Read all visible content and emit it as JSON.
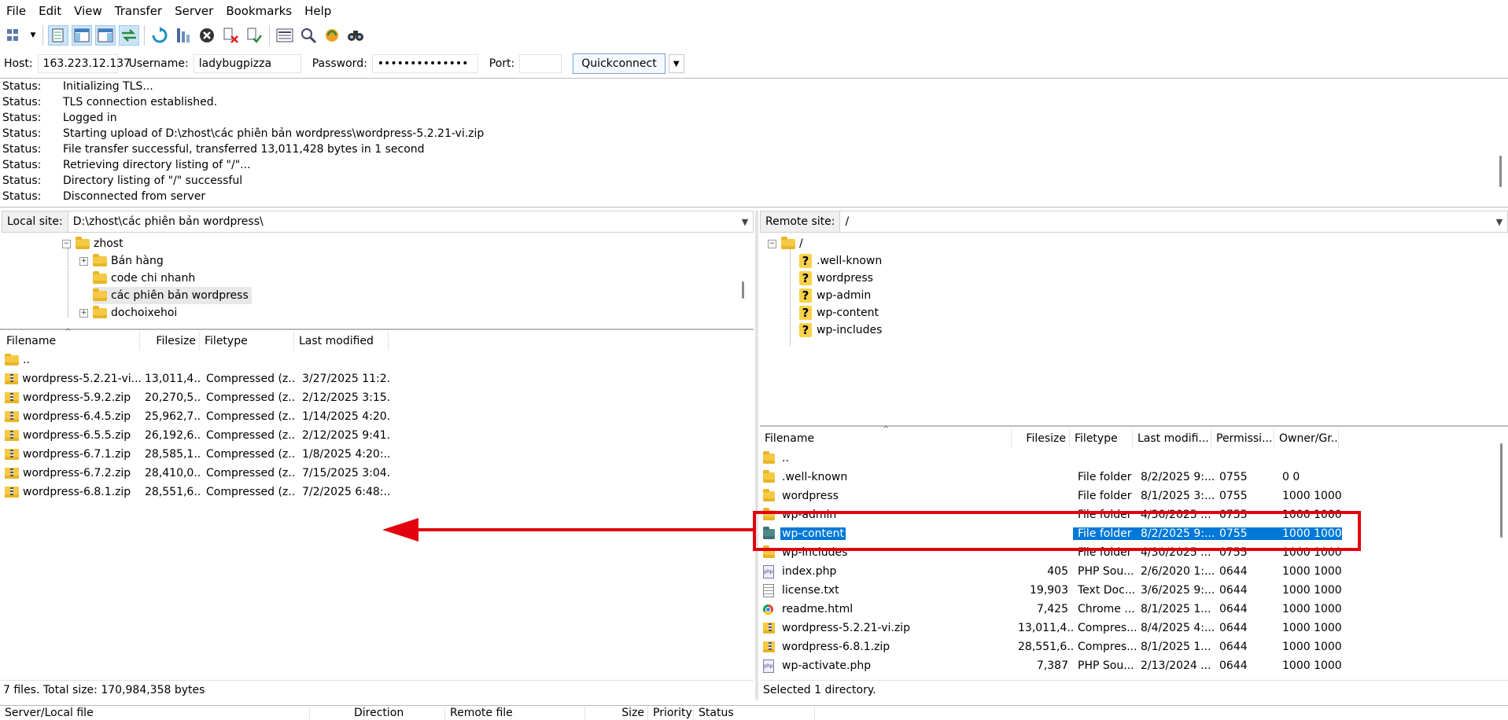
{
  "menu": [
    "File",
    "Edit",
    "View",
    "Transfer",
    "Server",
    "Bookmarks",
    "Help"
  ],
  "quickconnect": {
    "host_label": "Host:",
    "host_value": "163.223.12.137",
    "username_label": "Username:",
    "username_value": "ladybugpizza",
    "password_label": "Password:",
    "password_value": "••••••••••••••",
    "port_label": "Port:",
    "port_value": "",
    "button": "Quickconnect"
  },
  "log": [
    {
      "k": "Status:",
      "v": "Initializing TLS..."
    },
    {
      "k": "Status:",
      "v": "TLS connection established."
    },
    {
      "k": "Status:",
      "v": "Logged in"
    },
    {
      "k": "Status:",
      "v": "Starting upload of D:\\zhost\\các phiên bản wordpress\\wordpress-5.2.21-vi.zip"
    },
    {
      "k": "Status:",
      "v": "File transfer successful, transferred 13,011,428 bytes in 1 second"
    },
    {
      "k": "Status:",
      "v": "Retrieving directory listing of \"/\"..."
    },
    {
      "k": "Status:",
      "v": "Directory listing of \"/\" successful"
    },
    {
      "k": "Status:",
      "v": "Disconnected from server"
    }
  ],
  "local": {
    "site_label": "Local site:",
    "path": "D:\\zhost\\các phiên bản wordpress\\",
    "tree": [
      "zhost",
      "Bán hàng",
      "code chi nhanh",
      "các phiên bản wordpress",
      "dochoixehoi"
    ],
    "columns": [
      "Filename",
      "Filesize",
      "Filetype",
      "Last modified"
    ],
    "files": [
      {
        "name": "..",
        "size": "",
        "type": "",
        "modified": ""
      },
      {
        "name": "wordpress-5.2.21-vi...",
        "size": "13,011,4...",
        "type": "Compressed (z...",
        "modified": "3/27/2025 11:2..."
      },
      {
        "name": "wordpress-5.9.2.zip",
        "size": "20,270,5...",
        "type": "Compressed (z...",
        "modified": "2/12/2025 3:15..."
      },
      {
        "name": "wordpress-6.4.5.zip",
        "size": "25,962,7...",
        "type": "Compressed (z...",
        "modified": "1/14/2025 4:20..."
      },
      {
        "name": "wordpress-6.5.5.zip",
        "size": "26,192,6...",
        "type": "Compressed (z...",
        "modified": "2/12/2025 9:41..."
      },
      {
        "name": "wordpress-6.7.1.zip",
        "size": "28,585,1...",
        "type": "Compressed (z...",
        "modified": "1/8/2025 4:20:..."
      },
      {
        "name": "wordpress-6.7.2.zip",
        "size": "28,410,0...",
        "type": "Compressed (z...",
        "modified": "7/15/2025 3:04..."
      },
      {
        "name": "wordpress-6.8.1.zip",
        "size": "28,551,6...",
        "type": "Compressed (z...",
        "modified": "7/2/2025 6:48:..."
      }
    ],
    "status": "7 files. Total size: 170,984,358 bytes"
  },
  "remote": {
    "site_label": "Remote site:",
    "path": "/",
    "tree_root": "/",
    "tree": [
      ".well-known",
      "wordpress",
      "wp-admin",
      "wp-content",
      "wp-includes"
    ],
    "columns": [
      "Filename",
      "Filesize",
      "Filetype",
      "Last modifi...",
      "Permissi...",
      "Owner/Gr..."
    ],
    "files": [
      {
        "name": "..",
        "size": "",
        "type": "",
        "modified": "",
        "perm": "",
        "owner": "",
        "icon": "folder"
      },
      {
        "name": ".well-known",
        "size": "",
        "type": "File folder",
        "modified": "8/2/2025 9:...",
        "perm": "0755",
        "owner": "0 0",
        "icon": "folder"
      },
      {
        "name": "wordpress",
        "size": "",
        "type": "File folder",
        "modified": "8/1/2025 3:...",
        "perm": "0755",
        "owner": "1000 1000",
        "icon": "folder"
      },
      {
        "name": "wp-admin",
        "size": "",
        "type": "File folder",
        "modified": "4/30/2025 ...",
        "perm": "0755",
        "owner": "1000 1000",
        "icon": "folder"
      },
      {
        "name": "wp-content",
        "size": "",
        "type": "File folder",
        "modified": "8/2/2025 9:...",
        "perm": "0755",
        "owner": "1000 1000",
        "icon": "folder-teal"
      },
      {
        "name": "wp-includes",
        "size": "",
        "type": "File folder",
        "modified": "4/30/2025 ...",
        "perm": "0755",
        "owner": "1000 1000",
        "icon": "folder"
      },
      {
        "name": "index.php",
        "size": "405",
        "type": "PHP Sou...",
        "modified": "2/6/2020 1:...",
        "perm": "0644",
        "owner": "1000 1000",
        "icon": "php"
      },
      {
        "name": "license.txt",
        "size": "19,903",
        "type": "Text Doc...",
        "modified": "3/6/2025 9:...",
        "perm": "0644",
        "owner": "1000 1000",
        "icon": "txt"
      },
      {
        "name": "readme.html",
        "size": "7,425",
        "type": "Chrome ...",
        "modified": "8/1/2025 1...",
        "perm": "0644",
        "owner": "1000 1000",
        "icon": "chrome"
      },
      {
        "name": "wordpress-5.2.21-vi.zip",
        "size": "13,011,4...",
        "type": "Compres...",
        "modified": "8/4/2025 4:...",
        "perm": "0644",
        "owner": "1000 1000",
        "icon": "zip"
      },
      {
        "name": "wordpress-6.8.1.zip",
        "size": "28,551,6...",
        "type": "Compres...",
        "modified": "8/1/2025 1...",
        "perm": "0644",
        "owner": "1000 1000",
        "icon": "zip"
      },
      {
        "name": "wp-activate.php",
        "size": "7,387",
        "type": "PHP Sou...",
        "modified": "2/13/2024 ...",
        "perm": "0644",
        "owner": "1000 1000",
        "icon": "php"
      }
    ],
    "selected_index": 4,
    "status": "Selected 1 directory."
  },
  "queue": {
    "columns": [
      "Server/Local file",
      "Direction",
      "Remote file",
      "Size",
      "Priority",
      "Status"
    ]
  },
  "colors": {
    "selection": "#0078d7",
    "annotation": "#e3000f"
  }
}
